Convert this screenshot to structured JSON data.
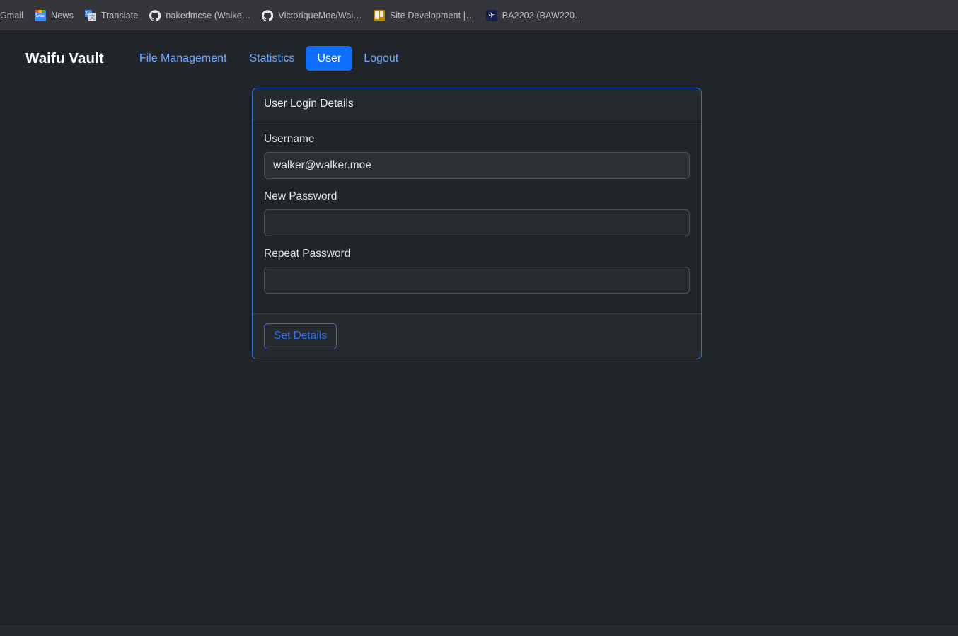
{
  "browser": {
    "bookmarks": [
      {
        "label": "Gmail",
        "icon": "none"
      },
      {
        "label": "News",
        "icon": "google-news-icon"
      },
      {
        "label": "Translate",
        "icon": "google-translate-icon"
      },
      {
        "label": "nakedmcse (Walke…",
        "icon": "github-icon"
      },
      {
        "label": "VictoriqueMoe/Wai…",
        "icon": "github-icon"
      },
      {
        "label": "Site Development |…",
        "icon": "board-icon"
      },
      {
        "label": "BA2202 (BAW220…",
        "icon": "flight-icon"
      }
    ]
  },
  "navbar": {
    "brand": "Waifu Vault",
    "links": [
      {
        "label": "File Management",
        "active": false
      },
      {
        "label": "Statistics",
        "active": false
      },
      {
        "label": "User",
        "active": true
      },
      {
        "label": "Logout",
        "active": false
      }
    ]
  },
  "card": {
    "header": "User Login Details",
    "fields": [
      {
        "label": "Username",
        "value": "walker@walker.moe",
        "placeholder": ""
      },
      {
        "label": "New Password",
        "value": "",
        "placeholder": ""
      },
      {
        "label": "Repeat Password",
        "value": "",
        "placeholder": ""
      }
    ],
    "submit_label": "Set Details"
  },
  "colors": {
    "page_background": "#212529",
    "bookmark_bar": "#35363a",
    "accent": "#0d6efd",
    "link": "#6ea8fe",
    "card_border": "#2f6fe0",
    "input_background": "#2b3035",
    "input_border": "#495057"
  }
}
